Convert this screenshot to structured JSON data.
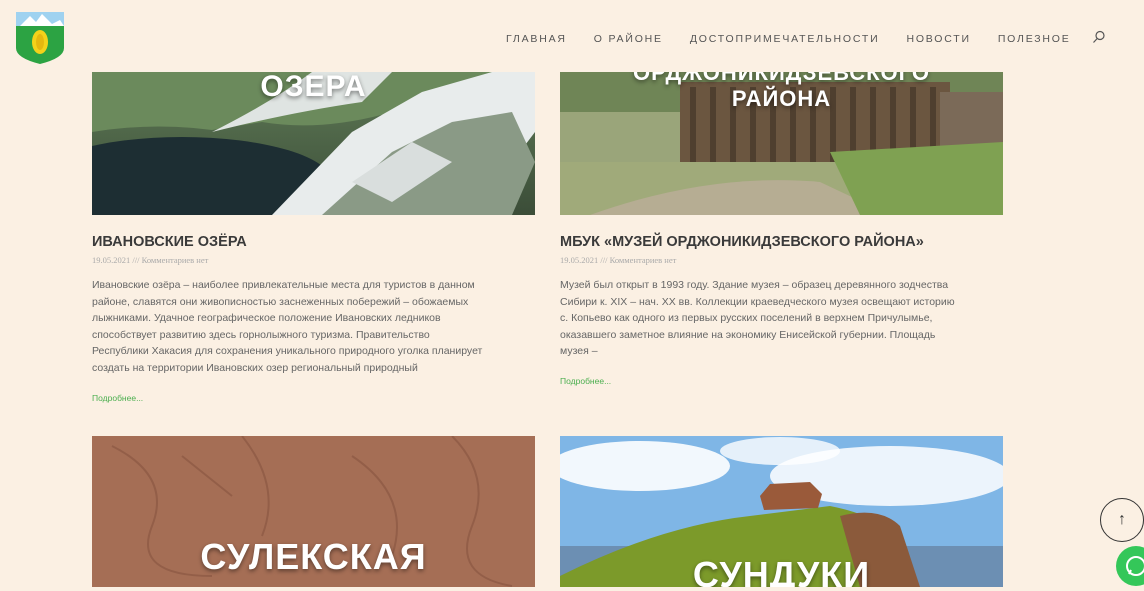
{
  "nav": {
    "items": [
      "ГЛАВНАЯ",
      "О РАЙОНЕ",
      "ДОСТОПРИМЕЧАТЕЛЬНОСТИ",
      "НОВОСТИ",
      "ПОЛЕЗНОЕ"
    ]
  },
  "posts": [
    {
      "image_text": "ОЗЕРА",
      "title": "ИВАНОВСКИЕ ОЗЁРА",
      "meta": "19.05.2021 /// Комментариев нет",
      "excerpt_lines": [
        "Ивановские озёра – наиболее привлекательные места для туристов в данном",
        "районе, славятся они живописностью заснеженных побережий – обожаемых",
        "лыжниками. Удачное географическое положение Ивановских ледников",
        "способствует развитию здесь горнолыжного туризма. Правительство",
        "Республики Хакасия для сохранения уникального природного уголка планирует",
        "создать на территории Ивановских озер региональный природный"
      ],
      "more": "Подробнее..."
    },
    {
      "image_text_top": "ОРДЖОНИКИДЗЕВСКОГО",
      "image_text": "РАЙОНА",
      "title": "МБУК «МУЗЕЙ ОРДЖОНИКИДЗЕВСКОГО РАЙОНА»",
      "meta": "19.05.2021 /// Комментариев нет",
      "excerpt_lines": [
        "Музей был открыт в 1993 году. Здание музея – образец деревянного зодчества",
        "Сибири к. XIX – нач. XX вв. Коллекции краеведческого музея освещают  историю",
        "с. Копьево как одного из первых русских поселений в верхнем Причулымье,",
        "оказавшего заметное влияние на экономику Енисейской губернии.  Площадь",
        "музея –"
      ],
      "more": "Подробнее..."
    },
    {
      "image_text": "СУЛЕКСКАЯ"
    },
    {
      "image_text": "СУНДУКИ"
    }
  ],
  "buttons": {
    "to_top": "↑"
  }
}
